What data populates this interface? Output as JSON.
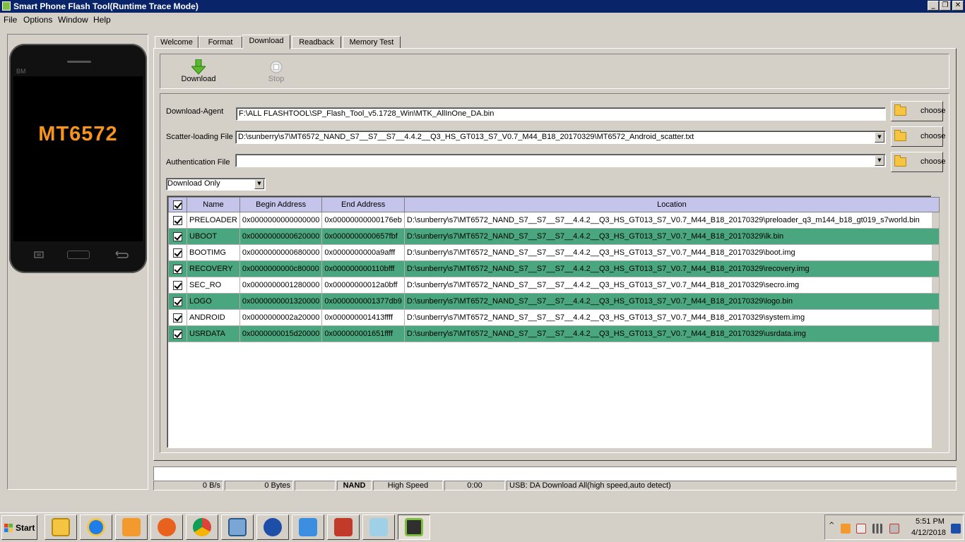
{
  "window": {
    "title": "Smart Phone Flash Tool(Runtime Trace Mode)",
    "minimize_glyph": "_",
    "restore_glyph": "❐",
    "close_glyph": "✕"
  },
  "menu": [
    "File",
    "Options",
    "Window",
    "Help"
  ],
  "phone": {
    "brand": "BM",
    "model": "MT6572"
  },
  "tabs": [
    "Welcome",
    "Format",
    "Download",
    "Readback",
    "Memory Test"
  ],
  "active_tab": "Download",
  "toolbar": {
    "download_label": "Download",
    "stop_label": "Stop"
  },
  "form": {
    "download_agent_label": "Download-Agent",
    "download_agent_value": "F:\\ALL FLASHTOOL\\SP_Flash_Tool_v5.1728_Win\\MTK_AllInOne_DA.bin",
    "scatter_label": "Scatter-loading File",
    "scatter_value": "D:\\sunberry\\s7\\MT6572_NAND_S7__S7__S7__4.4.2__Q3_HS_GT013_S7_V0.7_M44_B18_20170329\\MT6572_Android_scatter.txt",
    "auth_label": "Authentication File",
    "auth_value": "",
    "choose_label": "choose",
    "mode_value": "Download Only"
  },
  "table": {
    "headers": [
      "Name",
      "Begin Address",
      "End Address",
      "Location"
    ],
    "rows": [
      {
        "name": "PRELOADER",
        "begin": "0x0000000000000000",
        "end": "0x00000000000176eb",
        "location": "D:\\sunberry\\s7\\MT6572_NAND_S7__S7__S7__4.4.2__Q3_HS_GT013_S7_V0.7_M44_B18_20170329\\preloader_q3_m144_b18_gt019_s7world.bin"
      },
      {
        "name": "UBOOT",
        "begin": "0x0000000000620000",
        "end": "0x0000000000657fbf",
        "location": "D:\\sunberry\\s7\\MT6572_NAND_S7__S7__S7__4.4.2__Q3_HS_GT013_S7_V0.7_M44_B18_20170329\\lk.bin"
      },
      {
        "name": "BOOTIMG",
        "begin": "0x0000000000680000",
        "end": "0x0000000000a9afff",
        "location": "D:\\sunberry\\s7\\MT6572_NAND_S7__S7__S7__4.4.2__Q3_HS_GT013_S7_V0.7_M44_B18_20170329\\boot.img"
      },
      {
        "name": "RECOVERY",
        "begin": "0x0000000000c80000",
        "end": "0x000000000110bfff",
        "location": "D:\\sunberry\\s7\\MT6572_NAND_S7__S7__S7__4.4.2__Q3_HS_GT013_S7_V0.7_M44_B18_20170329\\recovery.img"
      },
      {
        "name": "SEC_RO",
        "begin": "0x0000000001280000",
        "end": "0x00000000012a0bff",
        "location": "D:\\sunberry\\s7\\MT6572_NAND_S7__S7__S7__4.4.2__Q3_HS_GT013_S7_V0.7_M44_B18_20170329\\secro.img"
      },
      {
        "name": "LOGO",
        "begin": "0x0000000001320000",
        "end": "0x0000000001377db9",
        "location": "D:\\sunberry\\s7\\MT6572_NAND_S7__S7__S7__4.4.2__Q3_HS_GT013_S7_V0.7_M44_B18_20170329\\logo.bin"
      },
      {
        "name": "ANDROID",
        "begin": "0x0000000002a20000",
        "end": "0x000000001413ffff",
        "location": "D:\\sunberry\\s7\\MT6572_NAND_S7__S7__S7__4.4.2__Q3_HS_GT013_S7_V0.7_M44_B18_20170329\\system.img"
      },
      {
        "name": "USRDATA",
        "begin": "0x0000000015d20000",
        "end": "0x000000001651ffff",
        "location": "D:\\sunberry\\s7\\MT6572_NAND_S7__S7__S7__4.4.2__Q3_HS_GT013_S7_V0.7_M44_B18_20170329\\usrdata.img"
      }
    ]
  },
  "status": {
    "speed": "0 B/s",
    "bytes": "0 Bytes",
    "storage": "NAND",
    "usb_speed": "High Speed",
    "time": "0:00",
    "message": "USB: DA Download All(high speed,auto detect)"
  },
  "taskbar": {
    "start_label": "Start",
    "clock_time": "5:51 PM",
    "clock_date": "4/12/2018"
  },
  "colors": {
    "titlebar": "#0a246a",
    "row_highlight": "#4aa67e",
    "header_bg": "#c5c5ec",
    "model_text": "#f7941d"
  }
}
